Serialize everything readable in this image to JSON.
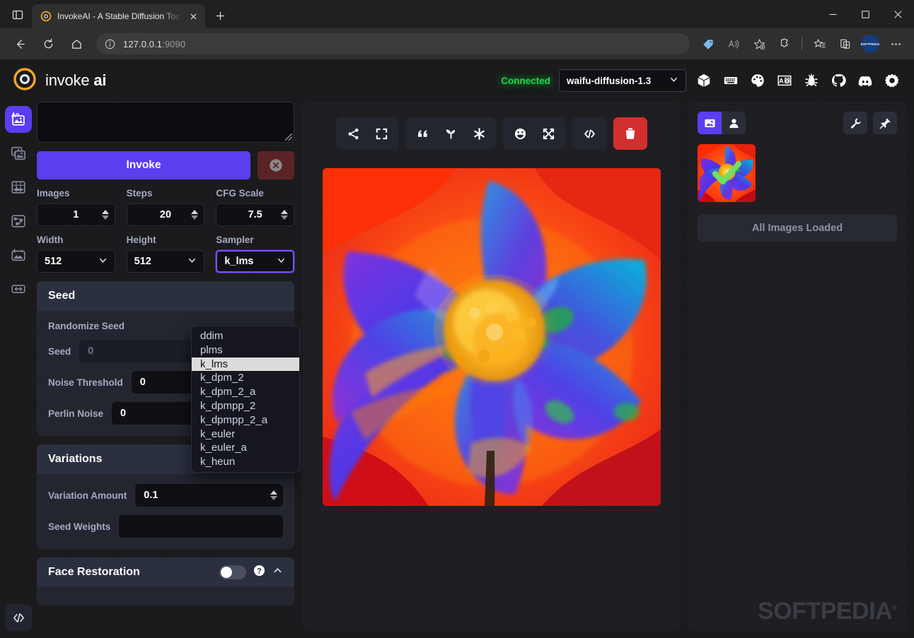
{
  "browser": {
    "tab": {
      "title": "InvokeAI - A Stable Diffusion Too",
      "favicon": "invokeai-logo-icon",
      "close_icon": "close-icon"
    },
    "new_tab_label": "+",
    "tab_search_icon": "tab-search-icon",
    "window_controls": {
      "minimize": "minimize-icon",
      "maximize": "maximize-icon",
      "close": "close-icon"
    },
    "toolbar": {
      "back_icon": "back-arrow-icon",
      "refresh_icon": "refresh-icon",
      "home_icon": "home-icon",
      "info_icon": "info-circle-icon",
      "url_host": "127.0.0.1",
      "url_port": ":9090",
      "icons": [
        "price-tag-icon",
        "read-aloud-icon",
        "add-favorite-icon",
        "extensions-icon",
        "favorites-icon",
        "collections-icon"
      ],
      "profile_label": "SOFTPEDIA",
      "more_icon": "more-options-icon"
    }
  },
  "app": {
    "logo": {
      "icon": "invokeai-logo-icon",
      "word1": "invoke",
      "word2": "ai"
    },
    "status": "Connected",
    "model_select": {
      "value": "waifu-diffusion-1.3",
      "chevron": "chevron-down-icon"
    },
    "header_icons": [
      "model-manager-icon",
      "keyboard-shortcuts-icon",
      "theme-icon",
      "language-icon",
      "bug-report-icon",
      "github-icon",
      "discord-icon",
      "settings-gear-icon"
    ]
  },
  "rail": {
    "items": [
      {
        "name": "text-to-image",
        "icon": "text-to-image-icon",
        "active": true
      },
      {
        "name": "image-to-image",
        "icon": "image-to-image-icon",
        "active": false
      },
      {
        "name": "unified-canvas",
        "icon": "unified-canvas-icon",
        "active": false
      },
      {
        "name": "nodes",
        "icon": "nodes-icon",
        "active": false
      },
      {
        "name": "post-processing",
        "icon": "post-processing-icon",
        "active": false
      },
      {
        "name": "training",
        "icon": "training-icon",
        "active": false
      }
    ],
    "bottom": {
      "name": "console-toggle",
      "icon": "code-icon"
    }
  },
  "options": {
    "prompt": {
      "value": "",
      "placeholder": ""
    },
    "invoke_label": "Invoke",
    "cancel_icon": "cancel-circle-icon",
    "fields": [
      {
        "label": "Images",
        "value": "1",
        "type": "number"
      },
      {
        "label": "Steps",
        "value": "20",
        "type": "number"
      },
      {
        "label": "CFG Scale",
        "value": "7.5",
        "type": "number"
      }
    ],
    "fields2": [
      {
        "label": "Width",
        "value": "512",
        "type": "select"
      },
      {
        "label": "Height",
        "value": "512",
        "type": "select"
      },
      {
        "label": "Sampler",
        "value": "k_lms",
        "type": "select",
        "focused": true
      }
    ],
    "sampler_options": [
      "ddim",
      "plms",
      "k_lms",
      "k_dpm_2",
      "k_dpm_2_a",
      "k_dpmpp_2",
      "k_dpmpp_2_a",
      "k_euler",
      "k_euler_a",
      "k_heun"
    ],
    "sampler_selected": "k_lms",
    "seed_card": {
      "title": "Seed",
      "randomize_label": "Randomize Seed",
      "seed_label": "Seed",
      "seed_value": "0",
      "noise_threshold_label": "Noise Threshold",
      "noise_threshold_value": "0",
      "perlin_noise_label": "Perlin Noise",
      "perlin_noise_value": "0"
    },
    "variations_card": {
      "title": "Variations",
      "toggle_on": true,
      "help_icon": "help-circle-icon",
      "collapse_icon": "chevron-up-icon",
      "amount_label": "Variation Amount",
      "amount_value": "0.1",
      "weights_label": "Seed Weights",
      "weights_value": ""
    },
    "face_card": {
      "title": "Face Restoration",
      "toggle_on": false,
      "help_icon": "help-circle-icon",
      "collapse_icon": "chevron-up-icon"
    }
  },
  "image_toolbar": {
    "groups": [
      [
        {
          "name": "share-button",
          "icon": "share-icon"
        },
        {
          "name": "fullscreen-button",
          "icon": "expand-icon"
        }
      ],
      [
        {
          "name": "use-prompt-button",
          "icon": "quote-icon"
        },
        {
          "name": "use-seed-button",
          "icon": "seedling-icon"
        },
        {
          "name": "use-all-parameters-button",
          "icon": "asterisk-icon"
        }
      ],
      [
        {
          "name": "restore-faces-button",
          "icon": "smiley-icon"
        },
        {
          "name": "upscale-button",
          "icon": "arrows-out-icon"
        }
      ],
      [
        {
          "name": "show-metadata-button",
          "icon": "code-icon"
        }
      ],
      [
        {
          "name": "delete-image-button",
          "icon": "trash-icon",
          "danger": true
        }
      ]
    ]
  },
  "gallery": {
    "tabs": [
      {
        "name": "generations-tab",
        "icon": "image-icon",
        "active": true
      },
      {
        "name": "uploads-tab",
        "icon": "person-icon",
        "active": false
      }
    ],
    "settings_icon": "wrench-icon",
    "pin_icon": "pin-icon",
    "thumb_selected_icon": "check-icon",
    "status": "All Images Loaded",
    "watermark": "SOFTPEDIA",
    "watermark_mark": "®"
  },
  "colors": {
    "accent": "#5c3df0",
    "danger": "#d32f2f",
    "connected": "#20d64b",
    "panel": "#23262f",
    "panel_head": "#2b3040",
    "input_bg": "#101014"
  }
}
